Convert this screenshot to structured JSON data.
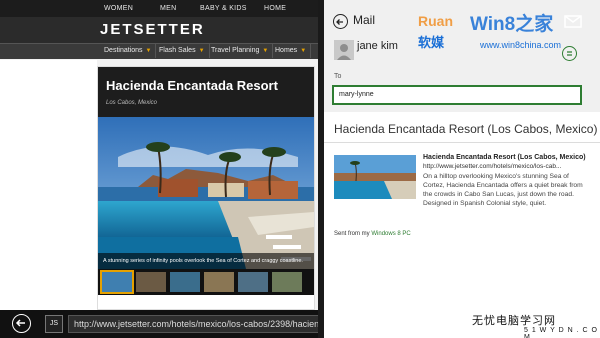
{
  "browser": {
    "top_nav": [
      "WOMEN",
      "MEN",
      "BABY & KIDS",
      "HOME"
    ],
    "logo": "JETSETTER",
    "categories": [
      "Destinations",
      "Flash Sales",
      "Travel Planning",
      "Homes"
    ],
    "article": {
      "title": "Hacienda Encantada Resort",
      "subtitle": "Los Cabos, Mexico",
      "caption": "A stunning series of infinity pools overlook the Sea of Cortez and craggy coastline."
    },
    "site_button": "JS",
    "url": "http://www.jetsetter.com/hotels/mexico/los-cabos/2398/hacienda-encantada-resort"
  },
  "mail": {
    "title": "Mail",
    "from_name": "jane kim",
    "to_label": "To",
    "to_value": "mary-lynne",
    "subject": "Hacienda Encantada Resort (Los Cabos, Mexico)",
    "snippet": {
      "title": "Hacienda Encantada Resort (Los Cabos, Mexico)",
      "url": "http://www.jetsetter.com/hotels/mexico/los-cab...",
      "body": "On a hilltop overlooking Mexico's stunning Sea of Cortez, Hacienda Encantada offers a quiet break from the crowds in Cabo San Lucas, just down the road. Designed in Spanish Colonial style, quiet."
    },
    "signature_prefix": "Sent from my",
    "signature_link": "Windows 8 PC"
  },
  "watermark": {
    "top_brand": "Win8之家",
    "top_cn": "软媒",
    "top_url": "www.win8china.com",
    "bottom_cn": "无忧电脑学习网",
    "bottom_url": "5 1 W Y D N . C O M"
  },
  "colors": {
    "accent_green": "#2e7d32",
    "caret_orange": "#e5a100",
    "watermark_blue": "#1a6fd6"
  }
}
